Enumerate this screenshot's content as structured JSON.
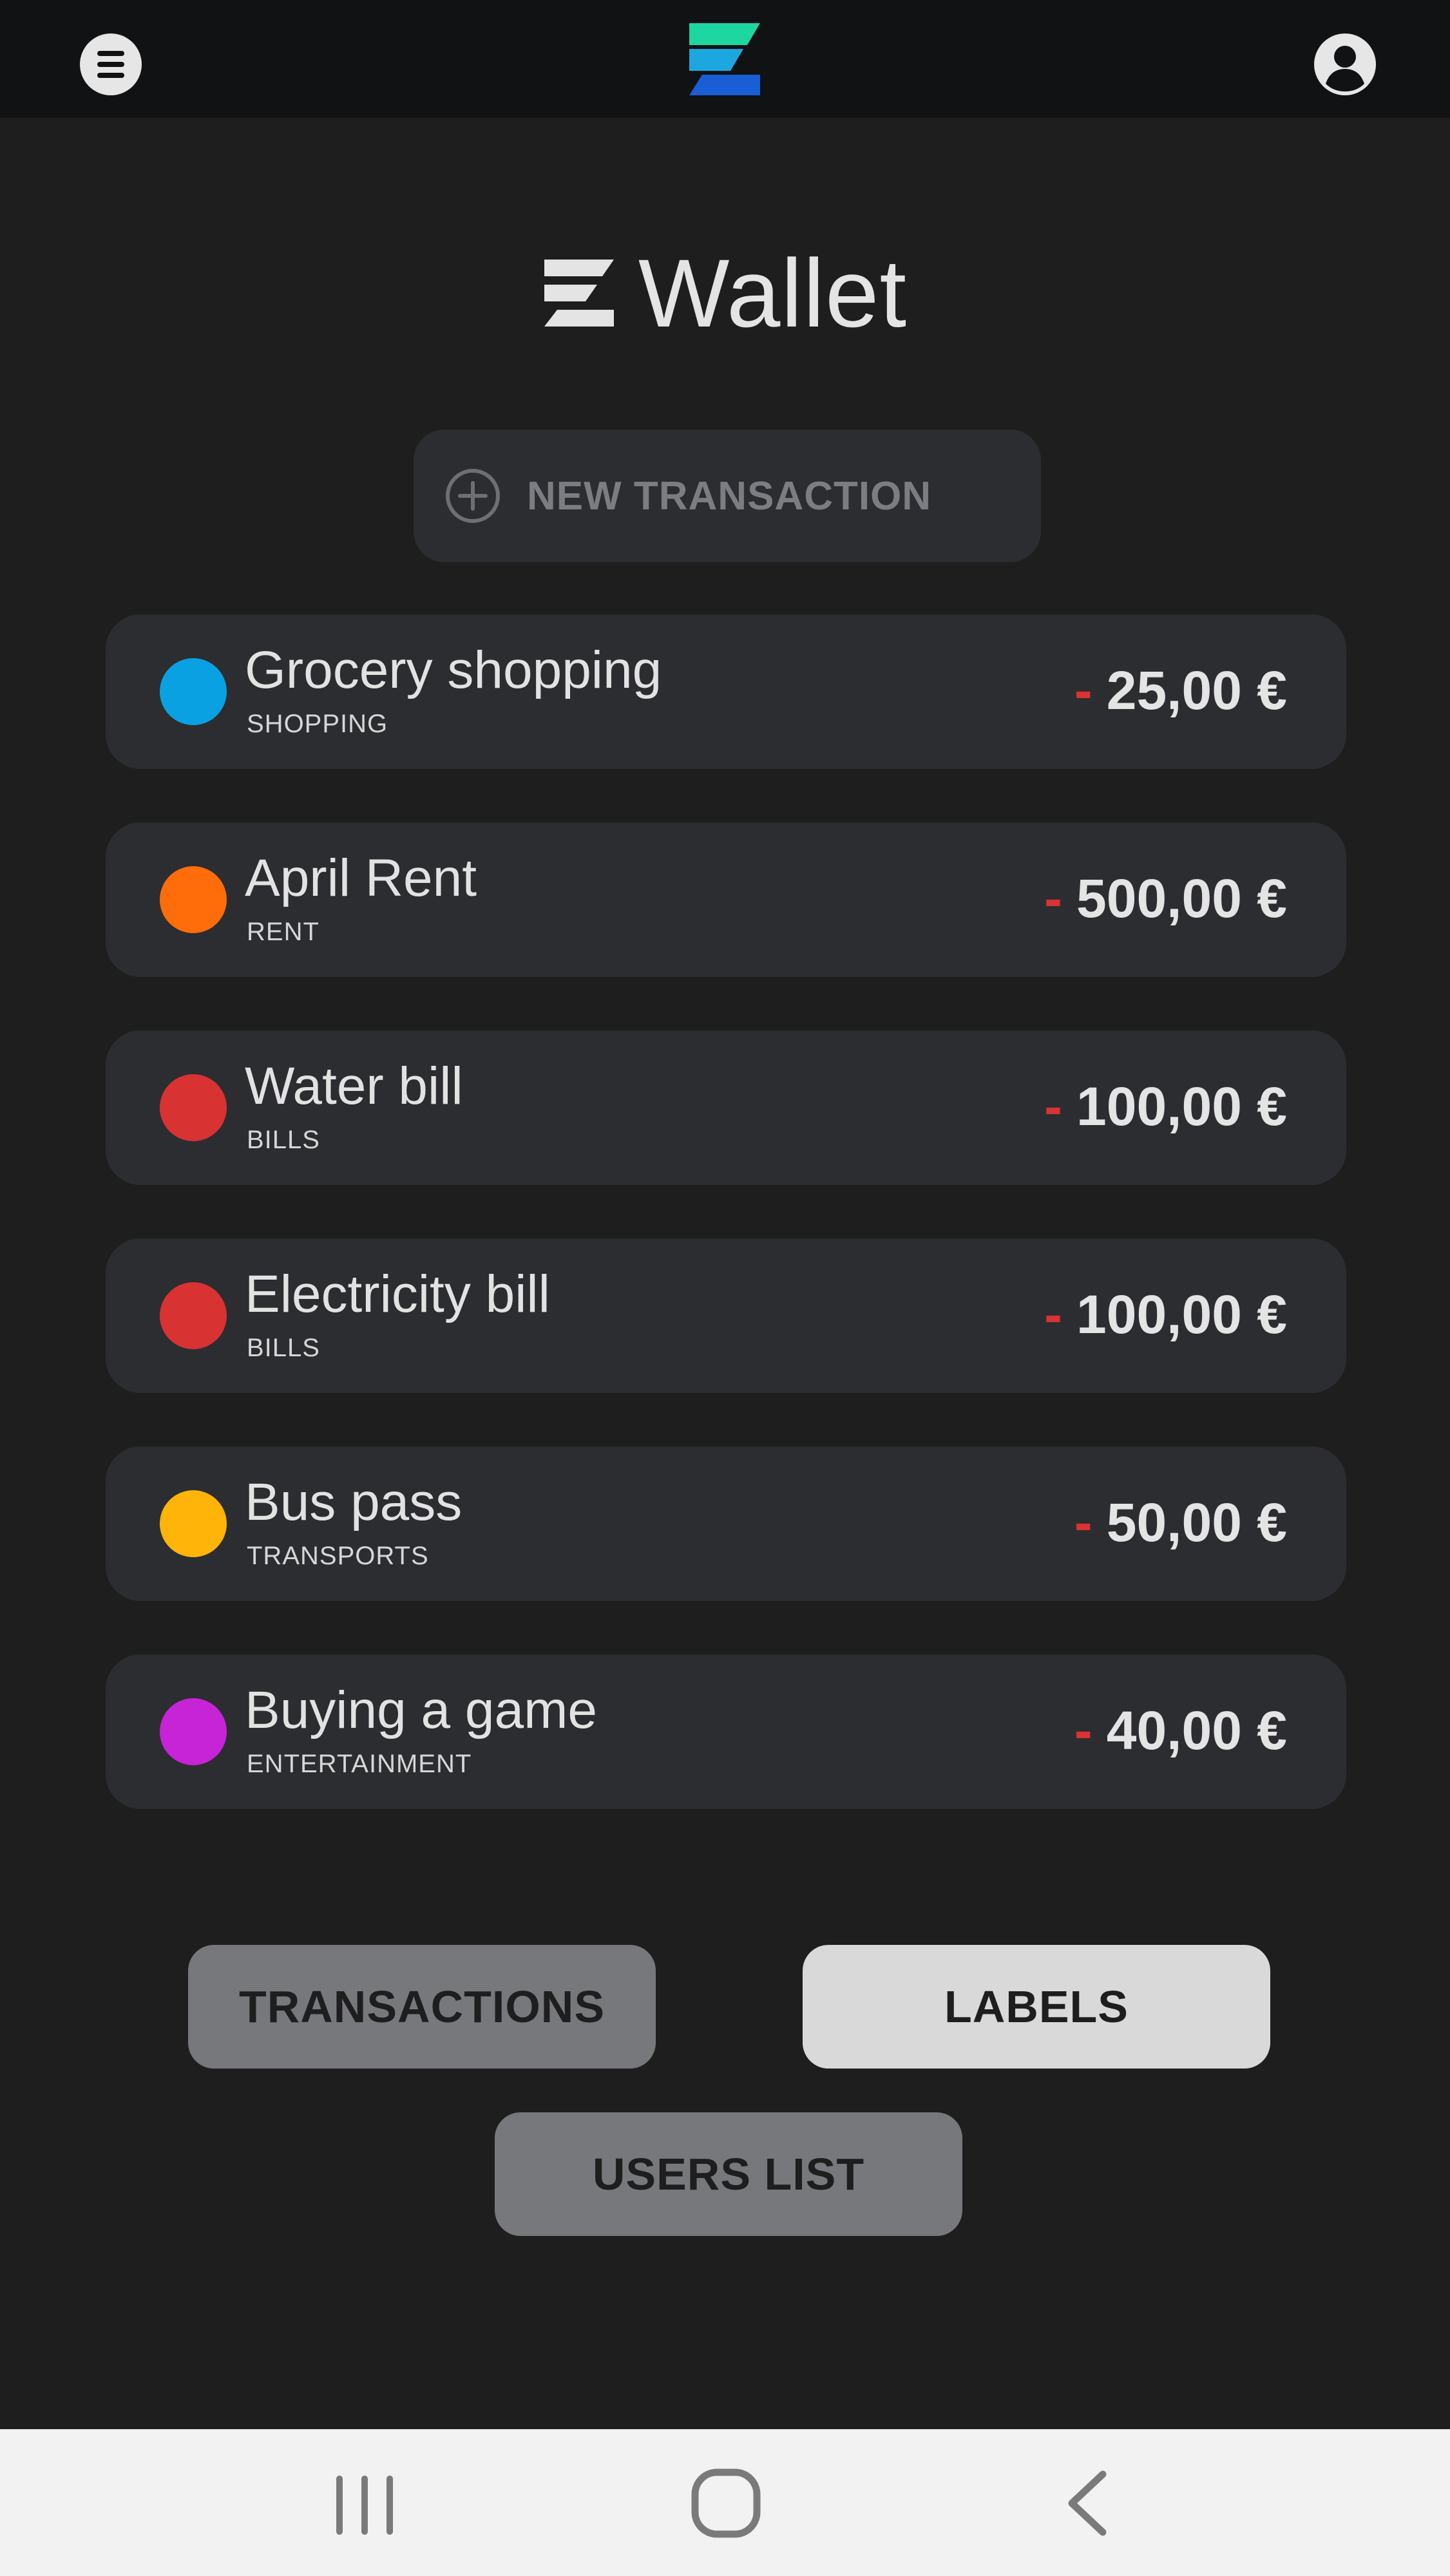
{
  "app": {
    "title": "Wallet",
    "brand_colors": {
      "logo_top": "#1ed6a0",
      "logo_mid": "#1ca7e0",
      "logo_bottom": "#1a5ed6"
    }
  },
  "topbar": {
    "menu_icon": "menu-icon",
    "logo_icon": "app-logo-icon",
    "profile_icon": "account-circle-icon"
  },
  "new_transaction": {
    "label": "NEW TRANSACTION",
    "icon": "plus-circle-icon"
  },
  "transactions": [
    {
      "name": "Grocery shopping",
      "category": "SHOPPING",
      "sign": "-",
      "amount": "25,00 €",
      "color": "#0aa1e2"
    },
    {
      "name": "April Rent",
      "category": "RENT",
      "sign": "-",
      "amount": "500,00 €",
      "color": "#ff6d0a"
    },
    {
      "name": "Water bill",
      "category": "BILLS",
      "sign": "-",
      "amount": "100,00 €",
      "color": "#d93232"
    },
    {
      "name": "Electricity bill",
      "category": "BILLS",
      "sign": "-",
      "amount": "100,00 €",
      "color": "#d93232"
    },
    {
      "name": "Bus pass",
      "category": "TRANSPORTS",
      "sign": "-",
      "amount": "50,00 €",
      "color": "#ffb40a"
    },
    {
      "name": "Buying a game",
      "category": "ENTERTAINMENT",
      "sign": "-",
      "amount": "40,00 €",
      "color": "#c624d6"
    }
  ],
  "bottom_buttons": {
    "transactions": "TRANSACTIONS",
    "labels": "LABELS",
    "users_list": "USERS LIST"
  },
  "system_nav": {
    "recent_icon": "recent-apps-icon",
    "home_icon": "home-icon",
    "back_icon": "back-icon"
  }
}
